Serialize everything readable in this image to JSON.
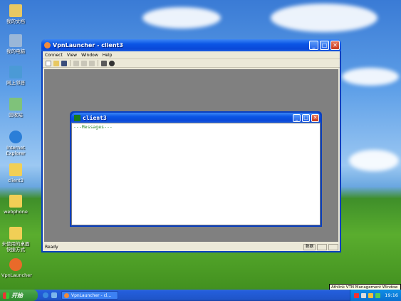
{
  "desktop": {
    "icons": [
      {
        "label": "我的文档",
        "color": "#e8c862",
        "icon": "folder-icon"
      },
      {
        "label": "我的电脑",
        "color": "#9ab7d8",
        "icon": "computer-icon"
      },
      {
        "label": "网上邻居",
        "color": "#4b9ad6",
        "icon": "network-icon"
      },
      {
        "label": "回收站",
        "color": "#7fc27a",
        "icon": "recycle-bin-icon"
      },
      {
        "label": "Internet Explorer",
        "color": "#2a7ed8",
        "icon": "ie-icon"
      },
      {
        "label": "client3",
        "color": "#f1cf56",
        "icon": "folder-icon"
      },
      {
        "label": "webphone",
        "color": "#f1cf56",
        "icon": "folder-icon"
      },
      {
        "label": "未使用的桌面快捷方式",
        "color": "#f1cf56",
        "icon": "folder-icon"
      },
      {
        "label": "VpnLauncher",
        "color": "#e96a2a",
        "icon": "app-icon"
      }
    ]
  },
  "main_window": {
    "title": "VpnLauncher - client3",
    "menus": [
      "Connect",
      "View",
      "Window",
      "Help"
    ],
    "toolbar_icons": [
      "new-icon",
      "open-icon",
      "save-icon",
      "cut-icon",
      "copy-icon",
      "paste-icon",
      "print-icon",
      "help-icon"
    ],
    "status_text": "Ready",
    "status_cells": [
      "数据",
      "",
      ""
    ]
  },
  "child_window": {
    "title": "client3",
    "messages_text": "---Messages---"
  },
  "taskbar": {
    "start_label": "开始",
    "task_label": "VpnLauncher - cl...",
    "clock": "19:16",
    "tooltip": "Athlink VTN Management Window"
  },
  "colors": {
    "title_blue": "#0a55e5",
    "message_green": "#2e8b2e",
    "mdi_gray": "#808080"
  }
}
